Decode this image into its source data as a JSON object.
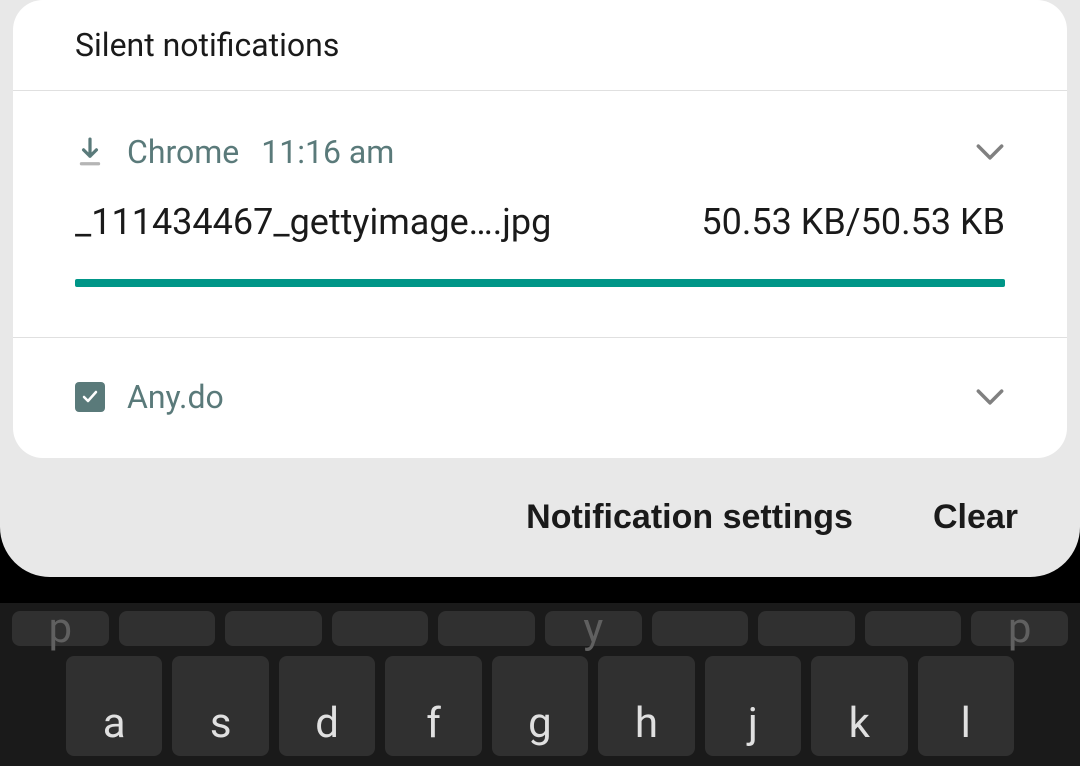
{
  "section_header": "Silent notifications",
  "accent_color": "#009688",
  "notifications": [
    {
      "app_name": "Chrome",
      "timestamp": "11:16 am",
      "filename": "_111434467_gettyimage….jpg",
      "filesize": "50.53 KB/50.53 KB",
      "icon": "download-icon",
      "progress_percent": 100
    },
    {
      "app_name": "Any.do",
      "icon": "checkbox-icon"
    }
  ],
  "actions": {
    "settings_label": "Notification settings",
    "clear_label": "Clear"
  },
  "keyboard": {
    "row_top": [
      "p",
      "",
      "",
      "",
      "",
      "y",
      "",
      "",
      "",
      "p"
    ],
    "row_middle": [
      "a",
      "s",
      "d",
      "f",
      "g",
      "h",
      "j",
      "k",
      "l"
    ]
  }
}
